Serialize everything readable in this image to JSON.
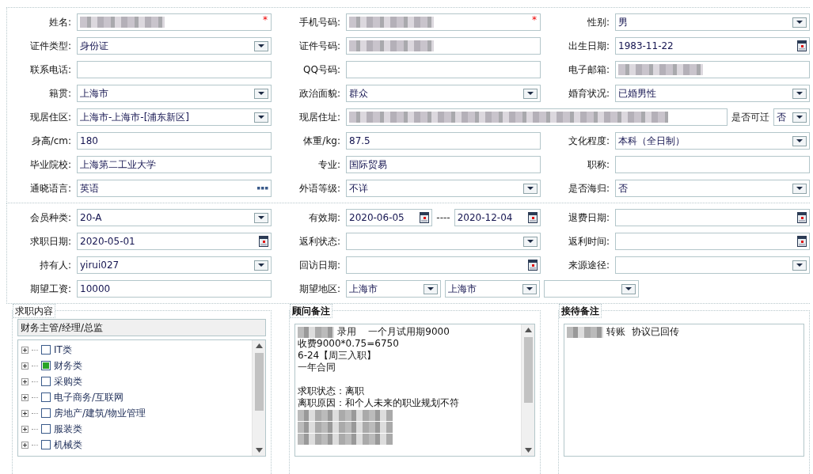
{
  "personal": {
    "rows": [
      [
        {
          "label": "姓名:",
          "controls": [
            {
              "kind": "text",
              "redacted": true,
              "required_mark": "*"
            }
          ]
        },
        {
          "label": "手机号码:",
          "controls": [
            {
              "kind": "text",
              "redacted": true,
              "required_mark": "*"
            }
          ]
        },
        {
          "label": "性别:",
          "controls": [
            {
              "kind": "select",
              "value": "男"
            }
          ]
        }
      ],
      [
        {
          "label": "证件类型:",
          "controls": [
            {
              "kind": "select",
              "value": "身份证"
            }
          ]
        },
        {
          "label": "证件号码:",
          "controls": [
            {
              "kind": "text",
              "redacted": true
            }
          ]
        },
        {
          "label": "出生日期:",
          "controls": [
            {
              "kind": "date",
              "value": "1983-11-22"
            }
          ]
        }
      ],
      [
        {
          "label": "联系电话:",
          "controls": [
            {
              "kind": "text"
            }
          ]
        },
        {
          "label": "QQ号码:",
          "controls": [
            {
              "kind": "text"
            }
          ]
        },
        {
          "label": "电子邮箱:",
          "controls": [
            {
              "kind": "text",
              "redacted": true
            }
          ]
        }
      ],
      [
        {
          "label": "籍贯:",
          "controls": [
            {
              "kind": "select",
              "value": "上海市"
            }
          ]
        },
        {
          "label": "政治面貌:",
          "controls": [
            {
              "kind": "select",
              "value": "群众"
            }
          ]
        },
        {
          "label": "婚育状况:",
          "controls": [
            {
              "kind": "select",
              "value": "已婚男性"
            }
          ]
        }
      ],
      [
        {
          "label": "现居住区:",
          "controls": [
            {
              "kind": "select",
              "value": "上海市-上海市-[浦东新区]"
            }
          ]
        },
        {
          "label": "现居住址:",
          "kind": "wide",
          "controls": [
            {
              "kind": "text",
              "redacted": true
            },
            {
              "kind": "label",
              "value": "是否可迁"
            },
            {
              "kind": "select",
              "value": "否",
              "compact": true
            }
          ]
        }
      ],
      [
        {
          "label": "身高/cm:",
          "controls": [
            {
              "kind": "text",
              "value": "180"
            }
          ]
        },
        {
          "label": "体重/kg:",
          "controls": [
            {
              "kind": "text",
              "value": "87.5"
            }
          ]
        },
        {
          "label": "文化程度:",
          "controls": [
            {
              "kind": "select",
              "value": "本科（全日制）"
            }
          ]
        }
      ],
      [
        {
          "label": "毕业院校:",
          "controls": [
            {
              "kind": "text",
              "value": "上海第二工业大学"
            }
          ]
        },
        {
          "label": "专业:",
          "controls": [
            {
              "kind": "text",
              "value": "国际贸易"
            }
          ]
        },
        {
          "label": "职称:",
          "controls": [
            {
              "kind": "text"
            }
          ]
        }
      ],
      [
        {
          "label": "通晓语言:",
          "controls": [
            {
              "kind": "more",
              "value": "英语"
            }
          ]
        },
        {
          "label": "外语等级:",
          "controls": [
            {
              "kind": "select",
              "value": "不详"
            }
          ]
        },
        {
          "label": "是否海归:",
          "controls": [
            {
              "kind": "select",
              "value": "否"
            }
          ]
        }
      ]
    ]
  },
  "membership": {
    "rows": [
      [
        {
          "label": "会员种类:",
          "controls": [
            {
              "kind": "select",
              "value": "20-A"
            }
          ]
        },
        {
          "label": "有效期:",
          "controls": [
            {
              "kind": "date",
              "value": "2020-06-05"
            },
            {
              "kind": "label",
              "value": "----"
            },
            {
              "kind": "date",
              "value": "2020-12-04"
            }
          ]
        },
        {
          "label": "退费日期:",
          "controls": [
            {
              "kind": "date"
            }
          ]
        }
      ],
      [
        {
          "label": "求职日期:",
          "controls": [
            {
              "kind": "date",
              "value": "2020-05-01"
            }
          ]
        },
        {
          "label": "返利状态:",
          "controls": [
            {
              "kind": "select"
            }
          ]
        },
        {
          "label": "返利时间:",
          "controls": [
            {
              "kind": "date"
            }
          ]
        }
      ],
      [
        {
          "label": "持有人:",
          "controls": [
            {
              "kind": "select",
              "value": "yirui027"
            }
          ]
        },
        {
          "label": "回访日期:",
          "controls": [
            {
              "kind": "date"
            }
          ]
        },
        {
          "label": "来源途径:",
          "controls": [
            {
              "kind": "select"
            }
          ]
        }
      ],
      [
        {
          "label": "期望工资:",
          "controls": [
            {
              "kind": "text",
              "value": "10000"
            }
          ]
        },
        {
          "label": "期望地区:",
          "kind": "wide",
          "controls": [
            {
              "kind": "select",
              "value": "上海市"
            },
            {
              "kind": "select",
              "value": "上海市"
            },
            {
              "kind": "select"
            }
          ]
        }
      ]
    ]
  },
  "panels": [
    {
      "kind": "tree",
      "legend": "求职内容",
      "summary": "财务主管/经理/总监",
      "scrollable": true,
      "items": [
        {
          "label": "IT类",
          "checked": false,
          "expanded": false
        },
        {
          "label": "财务类",
          "checked": true,
          "expanded": false
        },
        {
          "label": "采购类",
          "checked": false,
          "expanded": false
        },
        {
          "label": "电子商务/互联网",
          "checked": false,
          "expanded": false
        },
        {
          "label": "房地产/建筑/物业管理",
          "checked": false,
          "expanded": false
        },
        {
          "label": "服装类",
          "checked": false,
          "expanded": false
        },
        {
          "label": "机械类",
          "checked": false,
          "expanded": false
        }
      ]
    },
    {
      "kind": "notes",
      "legend": "顾问备注",
      "scrollable": true,
      "lines": [
        {
          "kind": "masked-text",
          "text": "录用    一个月试用期9000"
        },
        {
          "kind": "text",
          "text": "收费9000*0.75=6750"
        },
        {
          "kind": "text",
          "text": "6-24【周三入职】"
        },
        {
          "kind": "text",
          "text": "一年合同"
        },
        {
          "kind": "blank"
        },
        {
          "kind": "text",
          "text": "求职状态：离职"
        },
        {
          "kind": "text",
          "text": "离职原因：和个人未来的职业规划不符"
        },
        {
          "kind": "masked"
        },
        {
          "kind": "masked"
        },
        {
          "kind": "masked"
        }
      ]
    },
    {
      "kind": "notes",
      "legend": "接待备注",
      "scrollable": false,
      "lines": [
        {
          "kind": "masked-text",
          "text": "转账  协议已回传"
        }
      ]
    }
  ]
}
